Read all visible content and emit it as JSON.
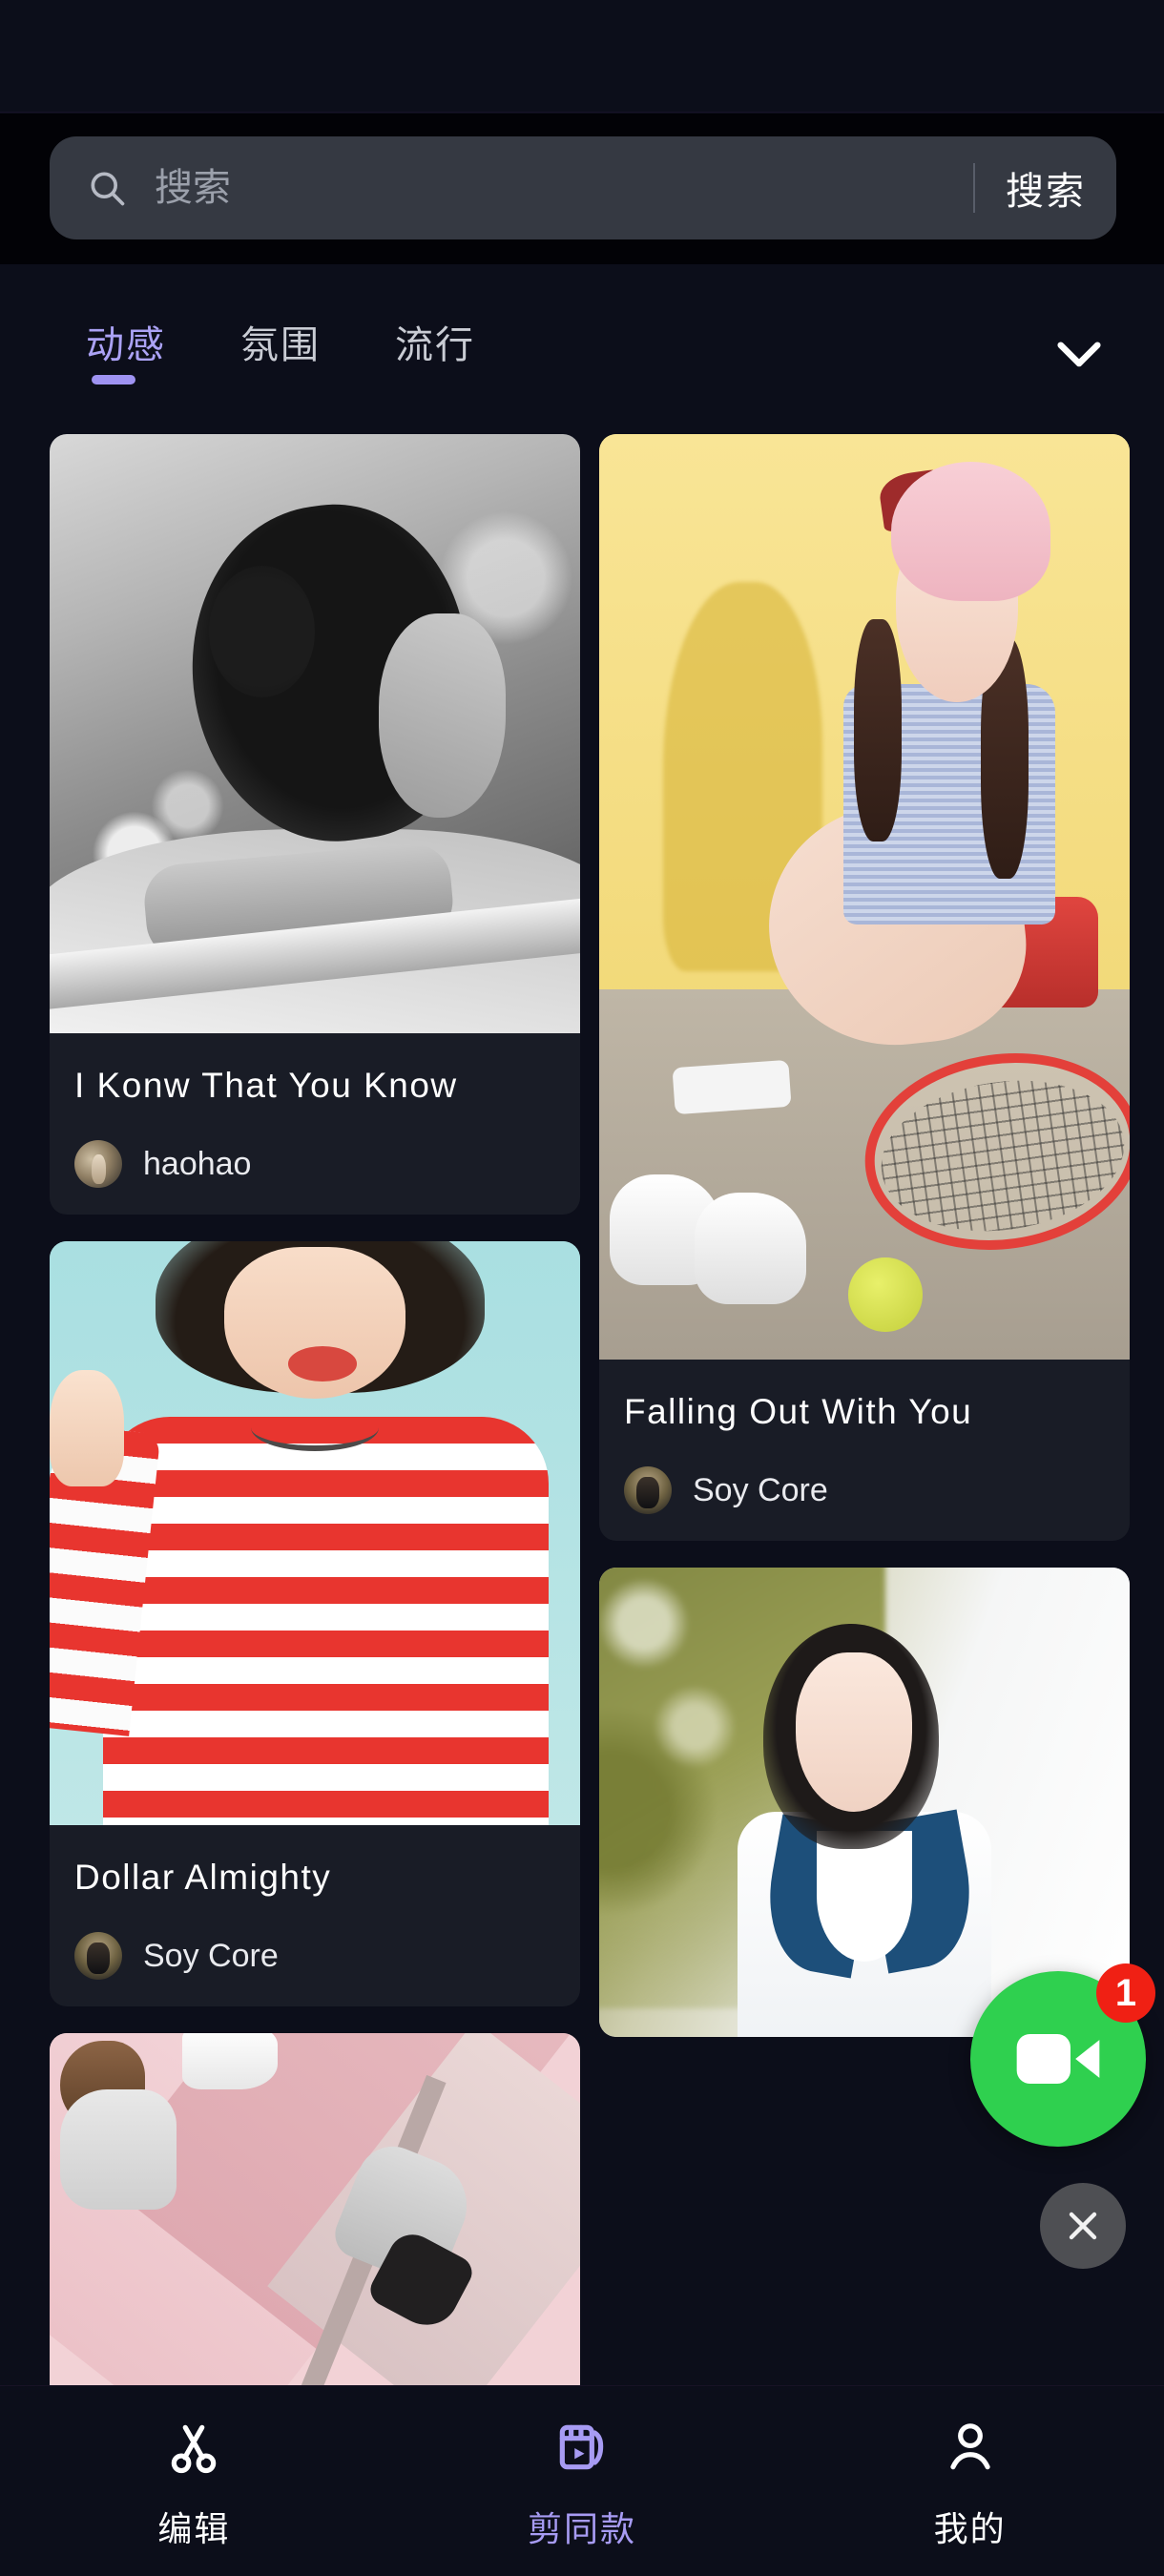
{
  "theme": {
    "page_bg": "#0c0e1a",
    "card_bg": "#191c26",
    "accent": "#a79bf3",
    "search_bg": "#353942",
    "badge_red": "#f02014",
    "facetime_green": "#2fd04f"
  },
  "search": {
    "placeholder": "搜索",
    "value": "",
    "submit_label": "搜索",
    "icon": "search-icon"
  },
  "tabs": {
    "items": [
      {
        "label": "动感",
        "active": true
      },
      {
        "label": "氛围",
        "active": false
      },
      {
        "label": "流行",
        "active": false
      }
    ],
    "expand_icon": "chevron-down-icon"
  },
  "feed": {
    "left_column": [
      {
        "title": "I Konw That You Know",
        "author": "haohao",
        "thumb": "black-and-white-portrait-woman-leaning-on-railing"
      },
      {
        "title": "Dollar Almighty",
        "author": "Soy Core",
        "thumb": "woman-in-red-white-striped-shirt-on-teal-background"
      },
      {
        "title": "",
        "author": "",
        "thumb": "pink-diagonal-collage-photo"
      }
    ],
    "right_column": [
      {
        "title": "Falling Out With You",
        "author": "Soy Core",
        "thumb": "girl-with-tennis-racket-on-yellow-background"
      },
      {
        "title": "",
        "author": "",
        "thumb": "girl-in-sailor-school-uniform-autumn-tree"
      }
    ]
  },
  "floating_call": {
    "icon": "video-camera-icon",
    "badge_count": "1",
    "close_icon": "close-icon"
  },
  "bottom_nav": {
    "items": [
      {
        "label": "编辑",
        "icon": "scissors-icon",
        "active": false
      },
      {
        "label": "剪同款",
        "icon": "clapperboard-play-icon",
        "active": true
      },
      {
        "label": "我的",
        "icon": "person-icon",
        "active": false
      }
    ]
  }
}
